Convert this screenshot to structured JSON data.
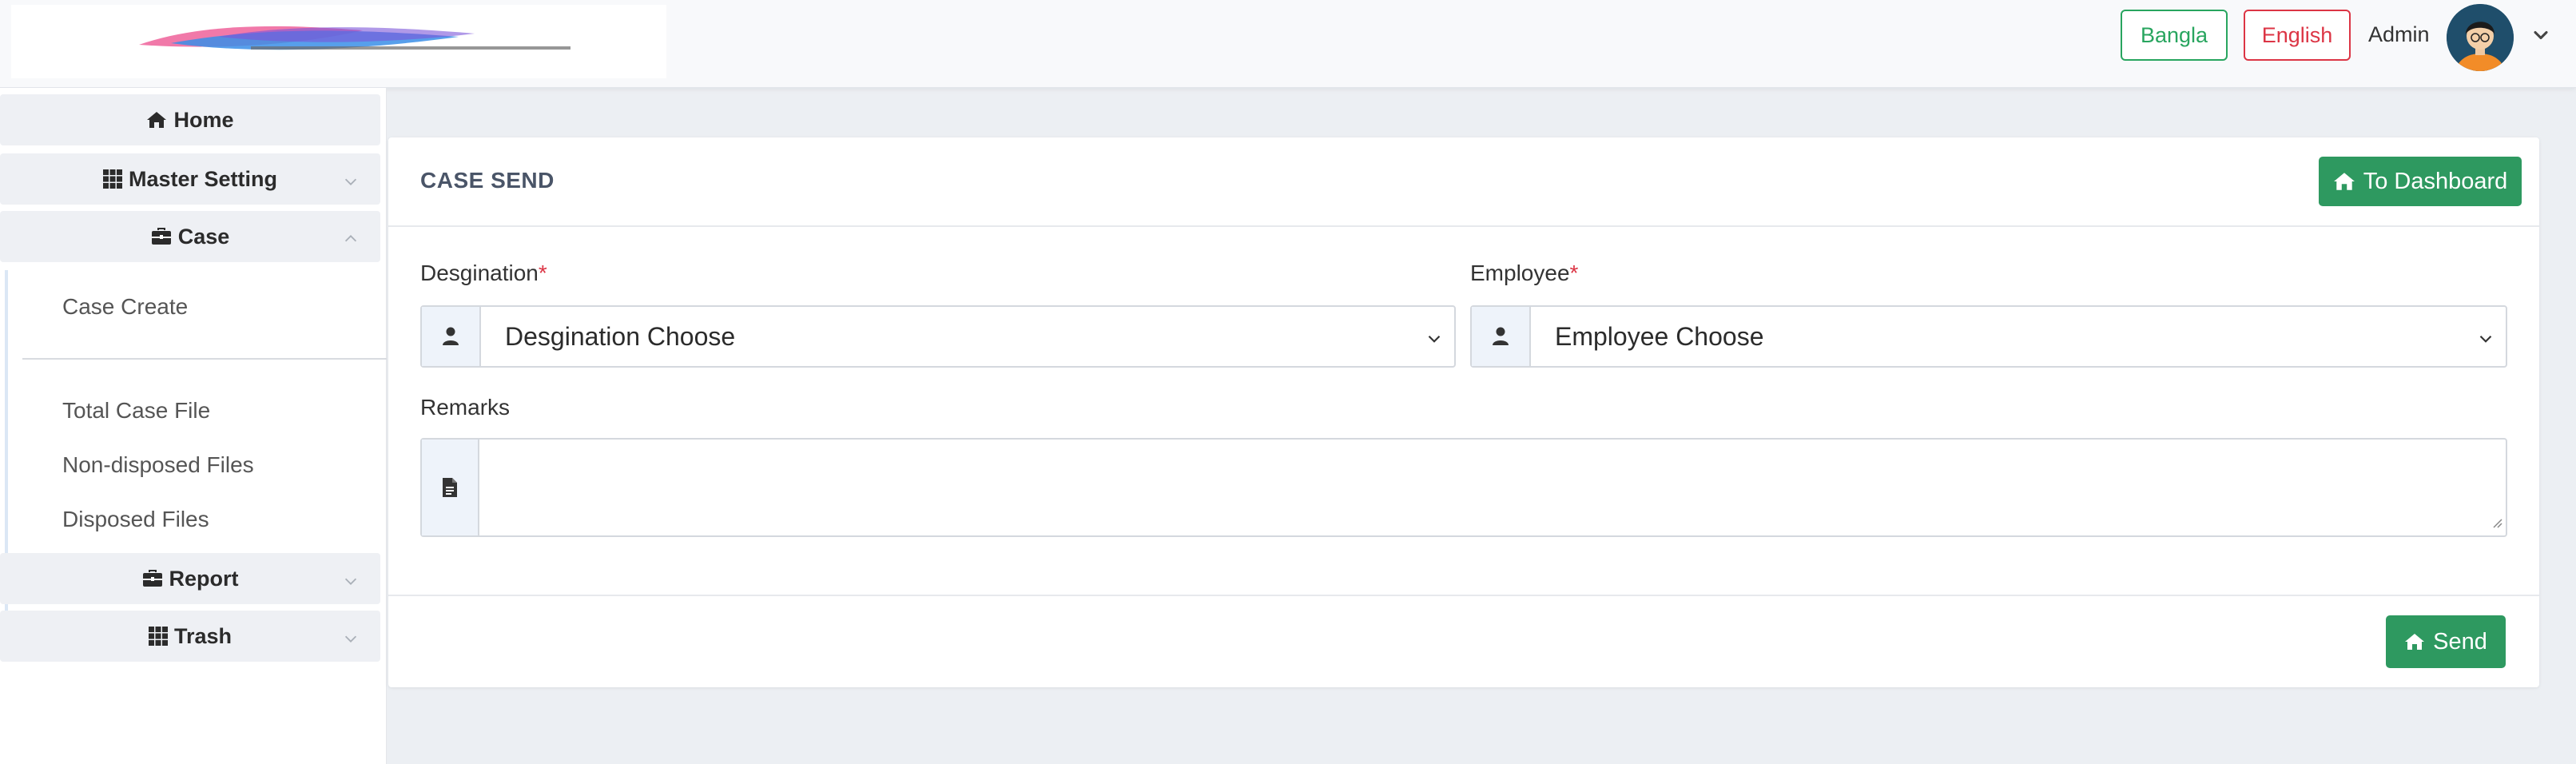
{
  "header": {
    "lang_bangla": "Bangla",
    "lang_english": "English",
    "admin_name": "Admin"
  },
  "sidebar": {
    "home": "Home",
    "master_setting": "Master Setting",
    "case": "Case",
    "case_items": [
      "Case Create",
      "Total Case File",
      "Non-disposed Files",
      "Disposed Files"
    ],
    "report": "Report",
    "trash": "Trash"
  },
  "card": {
    "title": "CASE SEND",
    "dashboard_button": "To Dashboard",
    "designation_label": "Desgination",
    "designation_value": "Desgination Choose",
    "employee_label": "Employee",
    "employee_value": "Employee Choose",
    "required_mark": "*",
    "remarks_label": "Remarks",
    "remarks_value": "",
    "send_button": "Send"
  },
  "colors": {
    "green": "#2e9960",
    "red": "#dc3545",
    "bangla_green": "#28a55f"
  },
  "icons": [
    "home-icon",
    "grid-icon",
    "briefcase-icon",
    "chevron-down-icon",
    "chevron-up-icon",
    "user-icon",
    "file-icon"
  ]
}
